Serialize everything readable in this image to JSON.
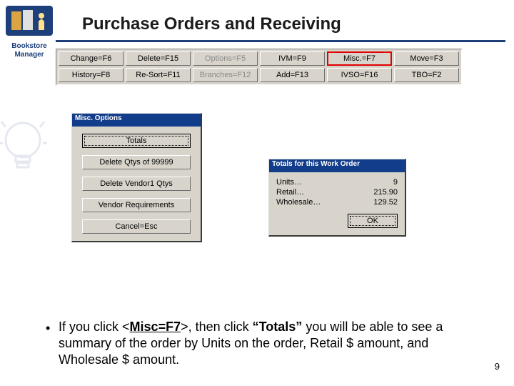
{
  "logo": {
    "line1": "Bookstore",
    "line2": "Manager"
  },
  "title": "Purchase Orders and Receiving",
  "toolbar": {
    "row1": [
      "Change=F6",
      "Delete=F15",
      "Options=F5",
      "IVM=F9",
      "Misc.=F7",
      "Move=F3"
    ],
    "row2": [
      "History=F8",
      "Re-Sort=F11",
      "Branches=F12",
      "Add=F13",
      "IVSO=F16",
      "TBO=F2"
    ],
    "disabled": [
      "Options=F5",
      "Branches=F12"
    ],
    "highlighted": "Misc.=F7"
  },
  "misc_window": {
    "title": "Misc. Options",
    "buttons": [
      "Totals",
      "Delete Qtys of 99999",
      "Delete Vendor1 Qtys",
      "Vendor Requirements",
      "Cancel=Esc"
    ],
    "focused": "Totals"
  },
  "totals_window": {
    "title": "Totals for this Work Order",
    "rows": [
      {
        "label": "Units…",
        "value": "9"
      },
      {
        "label": "Retail…",
        "value": "215.90"
      },
      {
        "label": "Wholesale…",
        "value": "129.52"
      }
    ],
    "ok_label": "OK"
  },
  "bullet": {
    "pre": "If you click <",
    "key": "Misc=F7",
    "post1": ">, then click ",
    "quoted": "“Totals”",
    "post2": " you will be able to see a summary of the order by Units on the order, Retail $ amount, and Wholesale $ amount."
  },
  "page_number": "9"
}
